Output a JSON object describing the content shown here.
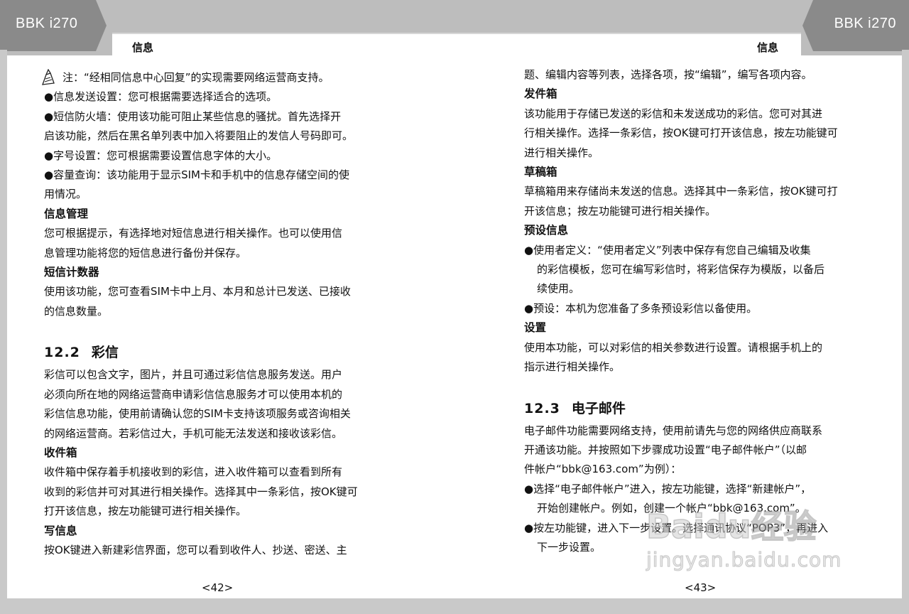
{
  "header": {
    "brand_left": "BBK i270",
    "brand_right": "BBK i270",
    "section_left": "信息",
    "section_right": "信息"
  },
  "left_page": {
    "note": "注：“经相同信息中心回复”的实现需要网络运营商支持。",
    "bullets_1": [
      "●信息发送设置：您可根据需要选择适合的选项。",
      "●短信防火墙：使用该功能可阻止某些信息的骚扰。首先选择开",
      "启该功能，然后在黑名单列表中加入将要阻止的发信人号码即可。",
      "●字号设置：您可根据需要设置信息字体的大小。",
      "●容量查询：该功能用于显示SIM卡和手机中的信息存储空间的使",
      "用情况。"
    ],
    "msg_mgmt_title": "信息管理",
    "msg_mgmt_lines": [
      "您可根据提示，有选择地对短信息进行相关操作。也可以使用信",
      "息管理功能将您的短信息进行备份并保存。"
    ],
    "counter_title": "短信计数器",
    "counter_lines": [
      "使用该功能，您可查看SIM卡中上月、本月和总计已发送、已接收",
      "的信息数量。"
    ],
    "mms_num": "12.2",
    "mms_title": "彩信",
    "mms_lines": [
      "彩信可以包含文字，图片，并且可通过彩信信息服务发送。用户",
      "必须向所在地的网络运营商申请彩信信息服务才可以使用本机的",
      "彩信信息功能，使用前请确认您的SIM卡支持该项服务或咨询相关",
      "的网络运营商。若彩信过大，手机可能无法发送和接收该彩信。"
    ],
    "inbox_title": "收件箱",
    "inbox_lines": [
      "收件箱中保存着手机接收到的彩信，进入收件箱可以查看到所有",
      "收到的彩信并可对其进行相关操作。选择其中一条彩信，按OK键可",
      "打开该信息，按左功能键可进行相关操作。"
    ],
    "write_title": "写信息",
    "write_lines": [
      "按OK键进入新建彩信界面，您可以看到收件人、抄送、密送、主"
    ],
    "page_number": "<42>"
  },
  "right_page": {
    "cont_line": "题、编辑内容等列表，选择各项，按“编辑”，编写各项内容。",
    "outbox_title": "发件箱",
    "outbox_lines": [
      "该功能用于存储已发送的彩信和未发送成功的彩信。您可对其进",
      "行相关操作。选择一条彩信，按OK键可打开该信息，按左功能键可",
      "进行相关操作。"
    ],
    "drafts_title": "草稿箱",
    "drafts_lines": [
      "草稿箱用来存储尚未发送的信息。选择其中一条彩信，按OK键可打",
      "开该信息；按左功能键可进行相关操作。"
    ],
    "preset_title": "预设信息",
    "preset_b1": "●使用者定义：“使用者定义”列表中保存有您自己编辑及收集",
    "preset_b1_cont": [
      "的彩信模板，您可在编写彩信时，将彩信保存为模版，以备后",
      "续使用。"
    ],
    "preset_b2": "●预设：本机为您准备了多条预设彩信以备使用。",
    "settings_title": "设置",
    "settings_lines": [
      "使用本功能，可以对彩信的相关参数进行设置。请根据手机上的",
      "指示进行相关操作。"
    ],
    "email_num": "12.3",
    "email_title": "电子邮件",
    "email_lines": [
      "电子邮件功能需要网络支持，使用前请先与您的网络供应商联系",
      "开通该功能。并按照如下步骤成功设置“电子邮件帐户”（以邮",
      "件帐户“bbk@163.com”为例）："
    ],
    "email_b1": "●选择“电子邮件帐户”进入，按左功能键，选择“新建帐户”，",
    "email_b1_cont": "开始创建帐户。例如，创建一个帐户“bbk@163.com”。",
    "email_b2": "●按左功能键，进入下一步设置。选择通讯协议“POP3”，再进入",
    "email_b2_cont": "下一步设置。",
    "page_number": "<43>"
  },
  "watermark": {
    "logo": "Baidu经验",
    "url": "jingyan.baidu.com"
  },
  "icons": {
    "note": "pencil-note-icon"
  }
}
